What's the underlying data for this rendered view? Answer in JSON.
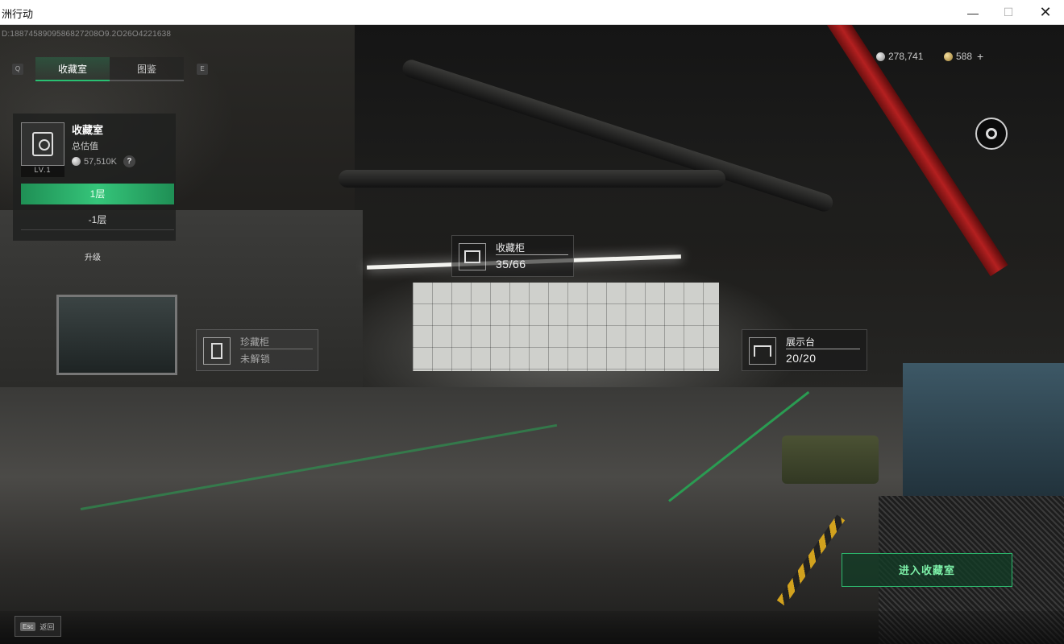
{
  "window": {
    "title": "洲行动",
    "min_glyph": "—",
    "max_glyph": "☐",
    "close_glyph": "✕"
  },
  "session_id": "D:1887458909586827208O9.2O26O4221638",
  "tab_keys": {
    "left": "Q",
    "right": "E"
  },
  "tabs": [
    {
      "label": "收藏室",
      "active": true
    },
    {
      "label": "图鉴",
      "active": false
    }
  ],
  "currency": {
    "silver": {
      "icon": "silver-coin-icon",
      "amount": "278,741"
    },
    "gold": {
      "icon": "gold-coin-icon",
      "amount": "588"
    },
    "add_label": "+"
  },
  "room": {
    "icon": "collection-room-icon",
    "level": "LV.1",
    "name": "收藏室",
    "value_label": "总估值",
    "value": "57,510K",
    "help_label": "?",
    "floors": [
      "1层",
      "-1层"
    ],
    "active_floor": 0
  },
  "upgrade_label": "升级",
  "points": [
    {
      "id": "display-cabinet",
      "label": "收藏柜",
      "value": "35/66",
      "locked": false,
      "icon": "cabinet-icon"
    },
    {
      "id": "treasure-cabinet",
      "label": "珍藏柜",
      "value": "未解锁",
      "locked": true,
      "icon": "safe-icon"
    },
    {
      "id": "display-stand",
      "label": "展示台",
      "value": "20/20",
      "locked": false,
      "icon": "stand-icon"
    }
  ],
  "enter_button": "进入收藏室",
  "esc": {
    "key": "Esc",
    "label": "返回"
  },
  "colors": {
    "accent_green": "#29c072",
    "panel_bg": "#1e201f"
  }
}
